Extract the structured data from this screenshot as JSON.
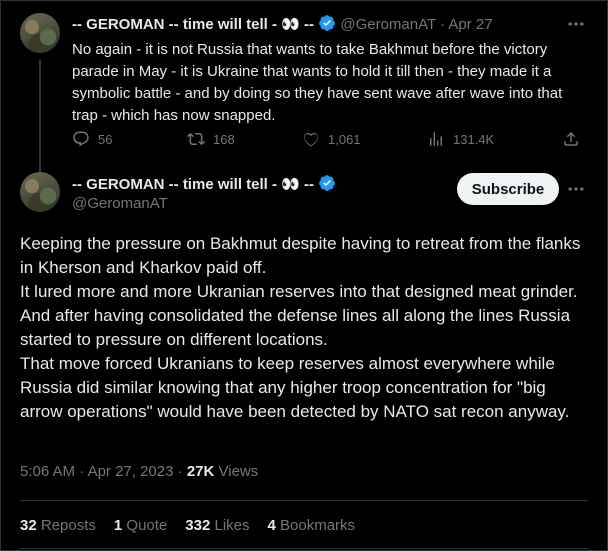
{
  "parent_tweet": {
    "author_name": "-- GEROMAN -- time will tell - 👀 --",
    "handle": "@GeromanAT",
    "separator": "·",
    "date": "Apr 27",
    "text": "No again - it is not Russia that wants to take Bakhmut before the victory parade in May - it is Ukraine that wants to hold it till then - they made it a symbolic battle - and by doing so they have sent wave after wave into that trap - which has now snapped.",
    "replies": "56",
    "reposts": "168",
    "likes": "1,061",
    "views": "131.4K"
  },
  "main_tweet": {
    "author_name": "-- GEROMAN -- time will tell - 👀 --",
    "handle": "@GeromanAT",
    "subscribe_label": "Subscribe",
    "paragraphs": [
      "Keeping the pressure on Bakhmut despite having to retreat from the flanks in Kherson and Kharkov paid off.",
      "It lured more and more Ukranian reserves into that designed meat grinder.",
      "And after having consolidated the defense lines all along the lines Russia started to pressure on different locations.",
      "That move forced Ukranians to keep reserves almost everywhere while Russia did similar knowing that any higher troop concentration for \"big arrow operations\" would have been detected by NATO sat recon anyway."
    ],
    "time": "5:06 AM",
    "separator": "·",
    "date": "Apr 27, 2023",
    "views_count": "27K",
    "views_label": "Views",
    "reposts_count": "32",
    "reposts_label": "Reposts",
    "quotes_count": "1",
    "quotes_label": "Quote",
    "likes_count": "332",
    "likes_label": "Likes",
    "bookmarks_count": "4",
    "bookmarks_label": "Bookmarks"
  },
  "colors": {
    "background": "#000000",
    "text": "#e7e9ea",
    "muted": "#71767b",
    "verified": "#1d9bf0",
    "divider": "#2f3336"
  }
}
